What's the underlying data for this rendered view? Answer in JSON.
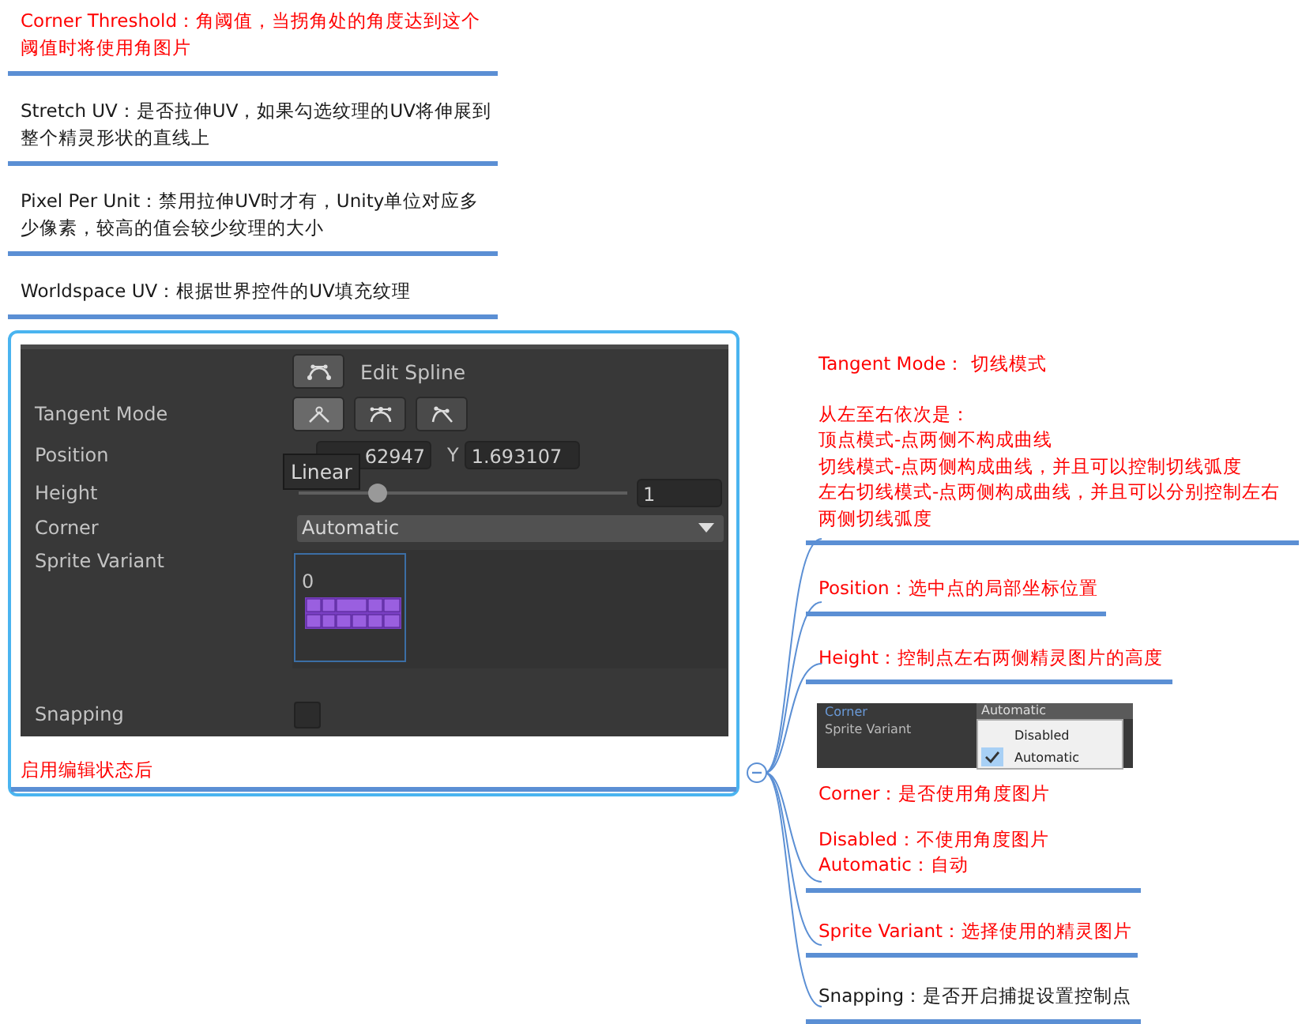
{
  "left_notes": [
    {
      "text": "Corner Threshold：角阈值，当拐角处的角度达到这个阈值时将使用角图片",
      "color": "#ff0000"
    },
    {
      "text": "Stretch UV：是否拉伸UV，如果勾选纹理的UV将伸展到整个精灵形状的直线上",
      "color": "#1a1a1a"
    },
    {
      "text": "Pixel Per Unit：禁用拉伸UV时才有，Unity单位对应多少像素，较高的值会较少纹理的大小",
      "color": "#1a1a1a"
    },
    {
      "text": "Worldspace UV：根据世界控件的UV填充纹理",
      "color": "#1a1a1a"
    }
  ],
  "central": {
    "inspector": {
      "edit_spline": {
        "label": "Edit Spline"
      },
      "tangent_mode": {
        "label": "Tangent Mode",
        "buttons": [
          {
            "kind": "linear",
            "selected": true
          },
          {
            "kind": "continuous",
            "selected": false
          },
          {
            "kind": "broken",
            "selected": false
          }
        ]
      },
      "position": {
        "label": "Position",
        "x_value": "62947",
        "y_axis": "Y",
        "y_value": "1.693107"
      },
      "tooltip": "Linear",
      "height": {
        "label": "Height",
        "level": 0.24,
        "value": "1"
      },
      "corner": {
        "label": "Corner",
        "value": "Automatic"
      },
      "sprite_variant": {
        "label": "Sprite Variant",
        "index": "0"
      },
      "snapping": {
        "label": "Snapping",
        "checked": false
      }
    },
    "caption": "启用编辑状态后"
  },
  "right_notes": [
    {
      "kind": "text",
      "color": "#ff0000",
      "paragraphs": [
        [
          "Tangent Mode： 切线模式"
        ],
        [
          "从左至右依次是：",
          "顶点模式-点两侧不构成曲线",
          "切线模式-点两侧构成曲线，并且可以控制切线弧度",
          "左右切线模式-点两侧构成曲线，并且可以分别控制左右两侧切线弧度"
        ]
      ]
    },
    {
      "kind": "text",
      "color": "#ff0000",
      "paragraphs": [
        [
          "Position：选中点的局部坐标位置"
        ]
      ]
    },
    {
      "kind": "text",
      "color": "#ff0000",
      "paragraphs": [
        [
          "Height：控制点左右两侧精灵图片的高度"
        ]
      ]
    },
    {
      "kind": "menu",
      "color": "#ff0000",
      "menu": {
        "label": "Corner",
        "label_2": "Sprite Variant",
        "header": "Automatic",
        "options": [
          {
            "label": "Disabled",
            "checked": false
          },
          {
            "label": "Automatic",
            "checked": true
          }
        ]
      },
      "paragraphs": [
        [
          "Corner：是否使用角度图片"
        ],
        [
          "Disabled：不使用角度图片",
          "Automatic：自动"
        ]
      ]
    },
    {
      "kind": "text",
      "color": "#ff0000",
      "paragraphs": [
        [
          "Sprite Variant：选择使用的精灵图片"
        ]
      ]
    },
    {
      "kind": "text",
      "color": "#1a1a1a",
      "paragraphs": [
        [
          "Snapping：是否开启捕捉设置控制点"
        ]
      ]
    }
  ]
}
